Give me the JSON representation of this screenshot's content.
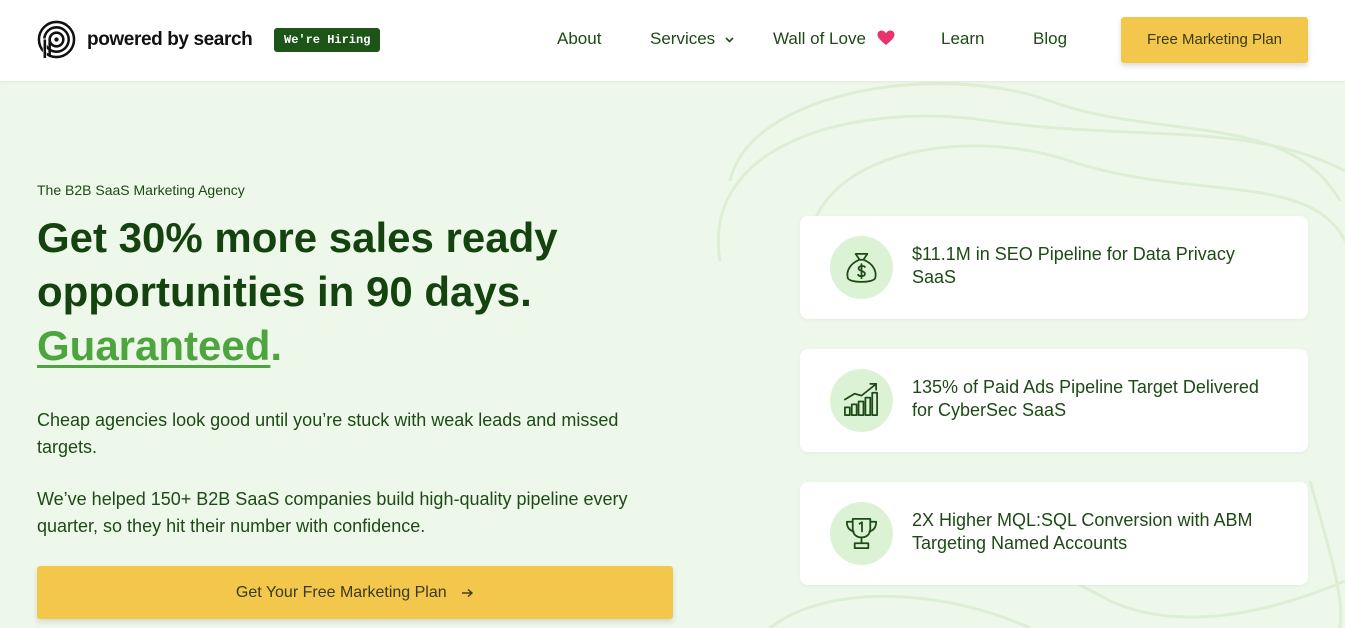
{
  "header": {
    "logo_text": "powered by search",
    "hiring_badge": "We're Hiring",
    "nav": {
      "about": "About",
      "services": "Services",
      "wall_of_love": "Wall of Love",
      "learn": "Learn",
      "blog": "Blog"
    },
    "cta_label": "Free Marketing Plan"
  },
  "hero": {
    "eyebrow": "The B2B SaaS Marketing Agency",
    "headline_line1": "Get 30% more sales ready",
    "headline_line2": "opportunities in 90 days.",
    "headline_highlight": "Guaranteed",
    "headline_period": ".",
    "paragraph_1": "Cheap agencies look good until you’re stuck with weak leads and missed targets.",
    "paragraph_2": "We’ve helped 150+ B2B SaaS companies build high-quality pipeline every quarter, so they hit their number with confidence.",
    "cta_label": "Get Your Free Marketing Plan"
  },
  "stats": [
    {
      "icon": "money-bag-icon",
      "text": "$11.1M in SEO Pipeline for Data Privacy SaaS"
    },
    {
      "icon": "growth-chart-icon",
      "text": "135% of Paid Ads Pipeline Target Delivered for CyberSec SaaS"
    },
    {
      "icon": "trophy-icon",
      "text": "2X Higher MQL:SQL Conversion with ABM Targeting Named Accounts"
    }
  ],
  "colors": {
    "brand_dark_green": "#14430f",
    "accent_green": "#4ea43e",
    "cta_yellow": "#f2c74c",
    "hiring_badge_bg": "#1d5519",
    "heart_pink": "#e8336d",
    "page_bg": "#eef8ea",
    "icon_circle_bg": "#dcf2d5"
  }
}
